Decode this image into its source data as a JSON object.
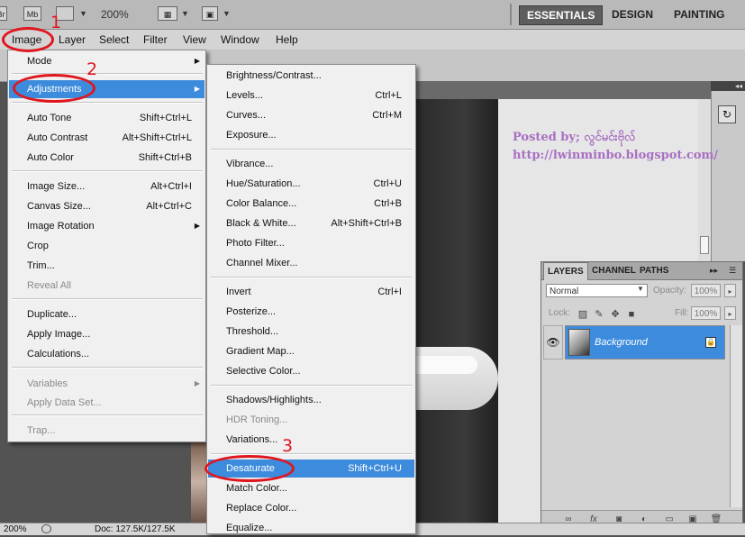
{
  "appbar": {
    "br_label": "Br",
    "mb_label": "Mb",
    "zoom": "200%",
    "workspaces": [
      "ESSENTIALS",
      "DESIGN",
      "PAINTING"
    ]
  },
  "menubar": [
    "Image",
    "Layer",
    "Select",
    "Filter",
    "View",
    "Window",
    "Help"
  ],
  "image_menu": {
    "items": [
      {
        "label": "Mode",
        "shortcut": "",
        "submenu": true
      },
      {
        "label": "Adjustments",
        "shortcut": "",
        "submenu": true
      },
      {
        "label": "Auto Tone",
        "shortcut": "Shift+Ctrl+L"
      },
      {
        "label": "Auto Contrast",
        "shortcut": "Alt+Shift+Ctrl+L"
      },
      {
        "label": "Auto Color",
        "shortcut": "Shift+Ctrl+B"
      },
      {
        "label": "Image Size...",
        "shortcut": "Alt+Ctrl+I"
      },
      {
        "label": "Canvas Size...",
        "shortcut": "Alt+Ctrl+C"
      },
      {
        "label": "Image Rotation",
        "shortcut": "",
        "submenu": true
      },
      {
        "label": "Crop",
        "shortcut": ""
      },
      {
        "label": "Trim...",
        "shortcut": ""
      },
      {
        "label": "Reveal All",
        "shortcut": "",
        "disabled": true
      },
      {
        "label": "Duplicate...",
        "shortcut": ""
      },
      {
        "label": "Apply Image...",
        "shortcut": ""
      },
      {
        "label": "Calculations...",
        "shortcut": ""
      },
      {
        "label": "Variables",
        "shortcut": "",
        "submenu": true,
        "disabled": true
      },
      {
        "label": "Apply Data Set...",
        "shortcut": "",
        "disabled": true
      },
      {
        "label": "Trap...",
        "shortcut": "",
        "disabled": true
      }
    ]
  },
  "adjustments_menu": {
    "items": [
      {
        "label": "Brightness/Contrast...",
        "shortcut": ""
      },
      {
        "label": "Levels...",
        "shortcut": "Ctrl+L"
      },
      {
        "label": "Curves...",
        "shortcut": "Ctrl+M"
      },
      {
        "label": "Exposure...",
        "shortcut": ""
      },
      {
        "label": "Vibrance...",
        "shortcut": ""
      },
      {
        "label": "Hue/Saturation...",
        "shortcut": "Ctrl+U"
      },
      {
        "label": "Color Balance...",
        "shortcut": "Ctrl+B"
      },
      {
        "label": "Black & White...",
        "shortcut": "Alt+Shift+Ctrl+B"
      },
      {
        "label": "Photo Filter...",
        "shortcut": ""
      },
      {
        "label": "Channel Mixer...",
        "shortcut": ""
      },
      {
        "label": "Invert",
        "shortcut": "Ctrl+I"
      },
      {
        "label": "Posterize...",
        "shortcut": ""
      },
      {
        "label": "Threshold...",
        "shortcut": ""
      },
      {
        "label": "Gradient Map...",
        "shortcut": ""
      },
      {
        "label": "Selective Color...",
        "shortcut": ""
      },
      {
        "label": "Shadows/Highlights...",
        "shortcut": ""
      },
      {
        "label": "HDR Toning...",
        "shortcut": "",
        "disabled": true
      },
      {
        "label": "Variations...",
        "shortcut": ""
      },
      {
        "label": "Desaturate",
        "shortcut": "Shift+Ctrl+U"
      },
      {
        "label": "Match Color...",
        "shortcut": ""
      },
      {
        "label": "Replace Color...",
        "shortcut": ""
      },
      {
        "label": "Equalize...",
        "shortcut": ""
      }
    ]
  },
  "annotations": [
    "1",
    "2",
    "3"
  ],
  "watermark": {
    "posted_by": "Posted by; လွင်မင်းဗိုလ်",
    "url": "http://lwinminbo.blogspot.com/"
  },
  "layers_panel": {
    "tabs": [
      "LAYERS",
      "CHANNEL",
      "PATHS"
    ],
    "blend_mode": "Normal",
    "opacity_label": "Opacity:",
    "opacity": "100%",
    "lock_label": "Lock:",
    "fill_label": "Fill:",
    "fill": "100%",
    "layer_name": "Background"
  },
  "statusbar": {
    "zoom": "200%",
    "doc": "Doc: 127.5K/127.5K"
  },
  "colors": {
    "highlight": "#3d8bdc",
    "annotation_red": "#e0161d",
    "watermark_purple": "#a86fc3"
  }
}
